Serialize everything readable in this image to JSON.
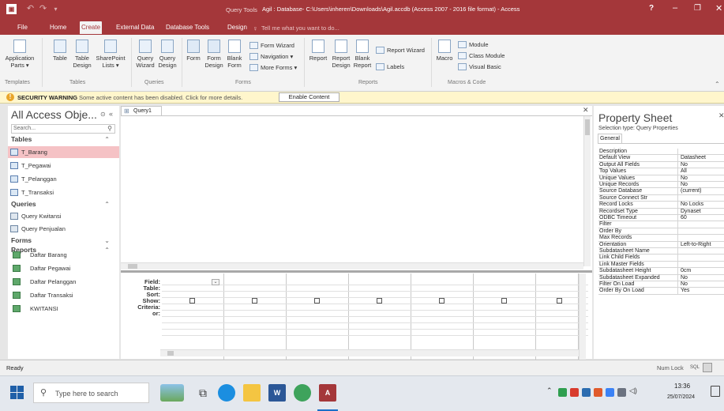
{
  "title": {
    "context": "Query Tools",
    "text": "Agil : Database- C:\\Users\\inheren\\Downloads\\Agil.accdb (Access 2007 - 2016 file format) - Access",
    "help": "?",
    "minimize": "–",
    "restore": "❐",
    "close": "✕"
  },
  "tabs": [
    "File",
    "Home",
    "Create",
    "External Data",
    "Database Tools",
    "Design"
  ],
  "tell_me": "Tell me what you want to do...",
  "ribbon": {
    "templates": {
      "group": "Templates",
      "application_parts": [
        "Application",
        "Parts ▾"
      ]
    },
    "tables": {
      "group": "Tables",
      "table": "Table",
      "table_design": [
        "Table",
        "Design"
      ],
      "sharepoint": [
        "SharePoint",
        "Lists ▾"
      ]
    },
    "queries": {
      "group": "Queries",
      "query_wizard": [
        "Query",
        "Wizard"
      ],
      "query_design": [
        "Query",
        "Design"
      ]
    },
    "forms": {
      "group": "Forms",
      "form": "Form",
      "form_design": [
        "Form",
        "Design"
      ],
      "blank_form": [
        "Blank",
        "Form"
      ],
      "form_wizard": "Form Wizard",
      "navigation": "Navigation ▾",
      "more_forms": "More Forms ▾"
    },
    "reports": {
      "group": "Reports",
      "report": "Report",
      "report_design": [
        "Report",
        "Design"
      ],
      "blank_report": [
        "Blank",
        "Report"
      ],
      "report_wizard": "Report Wizard",
      "labels": "Labels"
    },
    "macros": {
      "group": "Macros & Code",
      "macro": "Macro",
      "module": "Module",
      "class_module": "Class Module",
      "visual_basic": "Visual Basic"
    }
  },
  "security": {
    "warning": "SECURITY WARNING",
    "message": "Some active content has been disabled. Click for more details.",
    "button": "Enable Content"
  },
  "nav_pane": {
    "title": "All Access Obje...",
    "search_placeholder": "Search...",
    "sections": [
      {
        "name": "Tables",
        "items": [
          "T_Barang",
          "T_Pegawai",
          "T_Pelanggan",
          "T_Transaksi"
        ]
      },
      {
        "name": "Queries",
        "items": [
          "Query Kwitansi",
          "Query Penjualan"
        ]
      },
      {
        "name": "Forms",
        "items": []
      },
      {
        "name": "Reports",
        "items": [
          "Daftar Barang",
          "Daftar Pegawai",
          "Daftar Pelanggan",
          "Daftar Transaksi",
          "KWITANSI"
        ]
      }
    ],
    "selected": "T_Barang"
  },
  "query_tab": "Query1",
  "grid": {
    "row_labels": [
      "Field:",
      "Table:",
      "Sort:",
      "Show:",
      "Criteria:",
      "or:"
    ]
  },
  "property_sheet": {
    "title": "Property Sheet",
    "selection_type": "Selection type:  Query Properties",
    "tab": "General",
    "rows": [
      [
        "Description",
        ""
      ],
      [
        "Default View",
        "Datasheet"
      ],
      [
        "Output All Fields",
        "No"
      ],
      [
        "Top Values",
        "All"
      ],
      [
        "Unique Values",
        "No"
      ],
      [
        "Unique Records",
        "No"
      ],
      [
        "Source Database",
        "(current)"
      ],
      [
        "Source Connect Str",
        ""
      ],
      [
        "Record Locks",
        "No Locks"
      ],
      [
        "Recordset Type",
        "Dynaset"
      ],
      [
        "ODBC Timeout",
        "60"
      ],
      [
        "Filter",
        ""
      ],
      [
        "Order By",
        ""
      ],
      [
        "Max Records",
        ""
      ],
      [
        "Orientation",
        "Left-to-Right"
      ],
      [
        "Subdatasheet Name",
        ""
      ],
      [
        "Link Child Fields",
        ""
      ],
      [
        "Link Master Fields",
        ""
      ],
      [
        "Subdatasheet Height",
        "0cm"
      ],
      [
        "Subdatasheet Expanded",
        "No"
      ],
      [
        "Filter On Load",
        "No"
      ],
      [
        "Order By On Load",
        "Yes"
      ]
    ]
  },
  "status": {
    "left": "Ready",
    "num_lock": "Num Lock",
    "sql": "SQL"
  },
  "taskbar": {
    "search": "Type here to search",
    "time": "13:36",
    "date": "25/07/2024"
  }
}
